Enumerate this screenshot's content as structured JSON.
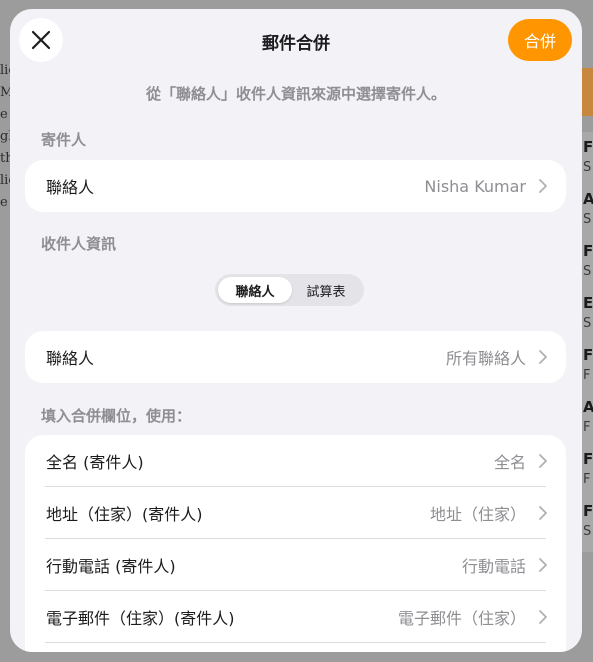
{
  "background": {
    "left_text_lines": [
      "lic",
      "M",
      "e f",
      "gh",
      "th",
      "lic",
      "e"
    ],
    "list_items": [
      {
        "t": "F",
        "s": "S"
      },
      {
        "t": "A",
        "s": "S"
      },
      {
        "t": "F",
        "s": "S"
      },
      {
        "t": "E",
        "s": "S"
      },
      {
        "t": "F",
        "s": "F"
      },
      {
        "t": "A",
        "s": "F"
      },
      {
        "t": "F",
        "s": "F"
      },
      {
        "t": "F",
        "s": "S"
      }
    ]
  },
  "sheet": {
    "title": "郵件合併",
    "merge_label": "合併",
    "subtitle": "從「聯絡人」收件人資訊來源中選擇寄件人。",
    "sender_section": "寄件人",
    "sender_row": {
      "label": "聯絡人",
      "value": "Nisha Kumar"
    },
    "recipient_section": "收件人資訊",
    "segments": {
      "selected": "聯絡人",
      "other": "試算表"
    },
    "recipient_row": {
      "label": "聯絡人",
      "value": "所有聯絡人"
    },
    "fields_section": "填入合併欄位，使用：",
    "field_rows": [
      {
        "label": "全名 (寄件人)",
        "value": "全名"
      },
      {
        "label": "地址（住家）(寄件人)",
        "value": "地址（住家）"
      },
      {
        "label": "行動電話 (寄件人)",
        "value": "行動電話"
      },
      {
        "label": "電子郵件（住家）(寄件人)",
        "value": "電子郵件（住家）"
      }
    ]
  },
  "colors": {
    "accent": "#ff9500",
    "sheet_bg": "#f2f2f7",
    "secondary_text": "#8e8e93"
  },
  "icons": {
    "close": "close-icon",
    "chevron": "chevron-right-icon"
  }
}
